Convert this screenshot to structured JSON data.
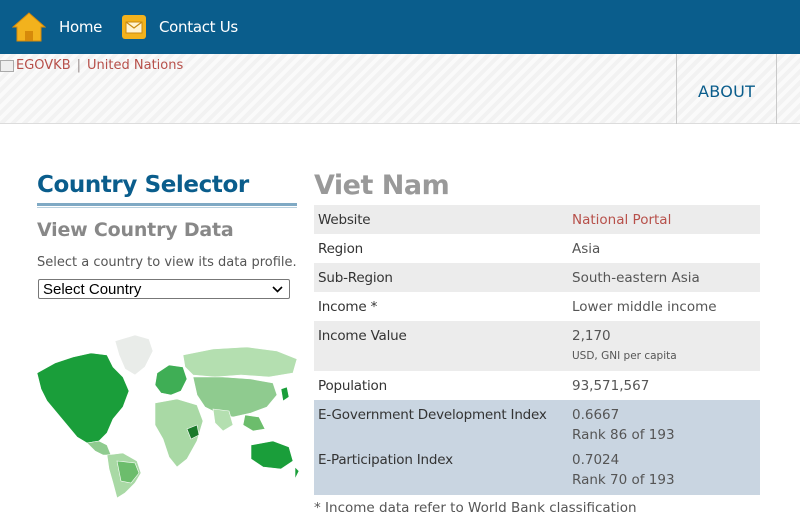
{
  "nav": {
    "home": "Home",
    "contact": "Contact Us"
  },
  "header": {
    "brand_alt": "EGOVKB",
    "brand_sep": "|",
    "brand_org": "United Nations",
    "about": "ABOUT"
  },
  "selector": {
    "title": "Country Selector",
    "subtitle": "View Country Data",
    "hint": "Select a country to view its data profile.",
    "selected": "Select Country"
  },
  "profile": {
    "country": "Viet Nam",
    "rows": [
      {
        "key": "Website",
        "value": "National Portal"
      },
      {
        "key": "Region",
        "value": "Asia"
      },
      {
        "key": "Sub-Region",
        "value": "South-eastern Asia"
      },
      {
        "key": "Income *",
        "value": "Lower middle income"
      },
      {
        "key": "Income Value",
        "value": "2,170",
        "note": "USD, GNI per capita"
      },
      {
        "key": "Population",
        "value": "93,571,567"
      },
      {
        "key": "E-Government Development Index",
        "value": "0.6667",
        "rank": "Rank 86 of 193"
      },
      {
        "key": "E-Participation Index",
        "value": "0.7024",
        "rank": "Rank 70 of 193"
      }
    ],
    "footnote": "* Income data refer to World Bank classification"
  },
  "colors": {
    "brand_blue": "#0a5d8c",
    "link_red": "#b7504a",
    "highlight_row": "#c9d5e1",
    "map_green": "#1a9e3a",
    "icon_gold": "#f2b21d"
  },
  "icons": {
    "home": "home-icon",
    "contact": "envelope-icon",
    "select": "chevron-down-icon"
  }
}
